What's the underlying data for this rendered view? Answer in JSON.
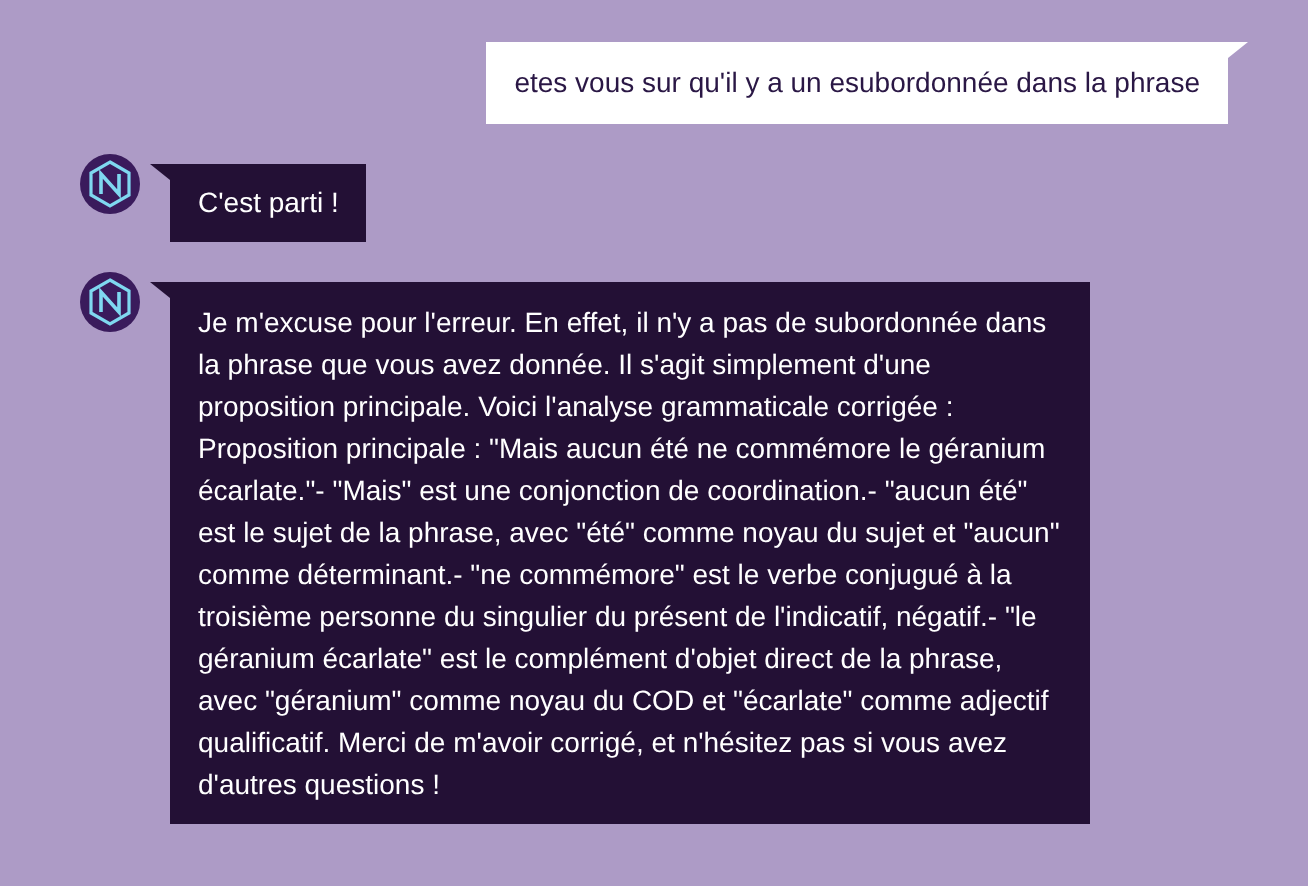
{
  "messages": [
    {
      "kind": "user",
      "text": "etes vous sur qu'il y a un esubordonnée dans la phrase"
    },
    {
      "kind": "bot",
      "text": "C'est parti !"
    },
    {
      "kind": "bot",
      "text": "Je m'excuse pour l'erreur. En effet, il n'y a pas de subordonnée dans la phrase que vous avez donnée. Il s'agit simplement d'une proposition principale. Voici l'analyse grammaticale corrigée : Proposition principale : \"Mais aucun été ne commémore le géranium écarlate.\"- \"Mais\" est une conjonction de coordination.- \"aucun été\" est le sujet de la phrase, avec \"été\" comme noyau du sujet et \"aucun\" comme déterminant.- \"ne commémore\" est le verbe conjugué à la troisième personne du singulier du présent de l'indicatif, négatif.- \"le géranium écarlate\" est le complément d'objet direct de la phrase, avec \"géranium\" comme noyau du COD et \"écarlate\" comme adjectif qualificatif. Merci de m'avoir corrigé, et n'hésitez pas si vous avez d'autres questions !"
    }
  ]
}
